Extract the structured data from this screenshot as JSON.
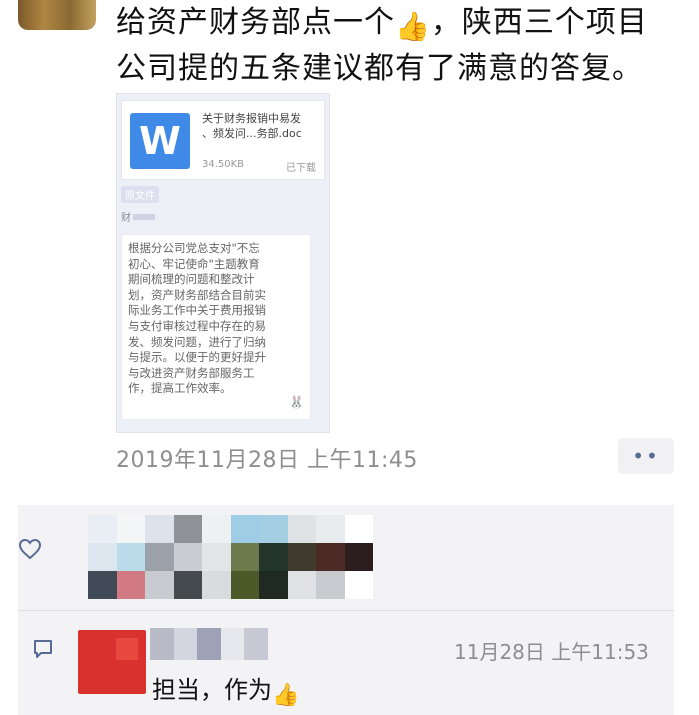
{
  "post": {
    "line1": "给资产财务部点一个",
    "line1_end": "，陕西三个项目",
    "line2": "公司提的五条建议都有了满意的答复。",
    "thumb_emoji": "👍"
  },
  "attachment": {
    "file_name_line1": "关于财务报销中易发",
    "file_name_line2": "、频发问...务部.doc",
    "icon_letter": "W",
    "file_size": "34.50KB",
    "download_status": "已下载",
    "tag": "原文件",
    "sender_prefix": "财",
    "message_lines": [
      "根据分公司党总支对\"不忘",
      "初心、牢记使命\"主题教育",
      "期间梳理的问题和整改计",
      "划，资产财务部结合目前实",
      "际业务工作中关于费用报销",
      "与支付审核过程中存在的易",
      "发、频发问题，进行了归纳",
      "与提示。以便于的更好提升",
      "与改进资产财务部服务工",
      "作，提高工作效率。"
    ]
  },
  "timestamp": "2019年11月28日 上午11:45",
  "more_button": "••",
  "comment": {
    "time": "11月28日 上午11:53",
    "text": "担当，作为",
    "thumb_emoji": "👍"
  },
  "colors": {
    "link_blue": "#576b95",
    "word_blue": "#3f8ae6",
    "avatar_red": "#d8312e"
  }
}
